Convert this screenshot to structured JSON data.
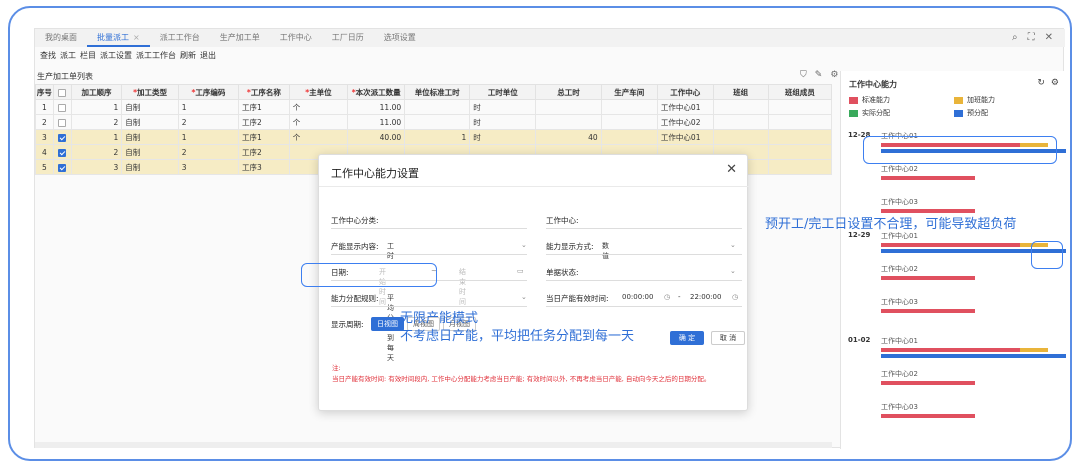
{
  "tabs": [
    {
      "label": "我的桌面",
      "active": false
    },
    {
      "label": "批量派工",
      "active": true,
      "closable": true
    },
    {
      "label": "派工工作台",
      "active": false
    },
    {
      "label": "生产加工单",
      "active": false
    },
    {
      "label": "工作中心",
      "active": false
    },
    {
      "label": "工厂日历",
      "active": false
    },
    {
      "label": "选项设置",
      "active": false
    }
  ],
  "tab_close_glyph": "×",
  "window_controls": [
    "search-icon",
    "expand-icon",
    "close-icon"
  ],
  "window_control_glyphs": [
    "⌕",
    "⛶",
    "✕"
  ],
  "menu": [
    "查找",
    "派工",
    "栏目",
    "派工设置",
    "派工工作台",
    "刷新",
    "退出"
  ],
  "list_title": "生产加工单列表",
  "list_icons": [
    "filter-icon",
    "edit-icon",
    "settings-icon"
  ],
  "list_icon_glyphs": [
    "⛉",
    "✎",
    "⚙"
  ],
  "table": {
    "columns": [
      {
        "label": "序号",
        "required": false
      },
      {
        "label": "",
        "checkbox": true
      },
      {
        "label": "加工顺序",
        "required": false
      },
      {
        "label": "加工类型",
        "required": true
      },
      {
        "label": "工序编码",
        "required": true
      },
      {
        "label": "工序名称",
        "required": true
      },
      {
        "label": "主单位",
        "required": true
      },
      {
        "label": "本次派工数量",
        "required": true
      },
      {
        "label": "单位标准工时",
        "required": false
      },
      {
        "label": "工时单位",
        "required": false
      },
      {
        "label": "总工时",
        "required": false
      },
      {
        "label": "生产车间",
        "required": false
      },
      {
        "label": "工作中心",
        "required": false
      },
      {
        "label": "班组",
        "required": false
      },
      {
        "label": "班组成员",
        "required": false
      }
    ],
    "rows": [
      {
        "seq": "1",
        "checked": false,
        "order": "1",
        "type": "自制",
        "code": "1",
        "name": "工序1",
        "unit": "个",
        "qty": "11.00",
        "std": "",
        "tunit": "时",
        "total": "",
        "shop": "",
        "center": "工作中心01",
        "team": "",
        "member": "",
        "highlight": false
      },
      {
        "seq": "2",
        "checked": false,
        "order": "2",
        "type": "自制",
        "code": "2",
        "name": "工序2",
        "unit": "个",
        "qty": "11.00",
        "std": "",
        "tunit": "时",
        "total": "",
        "shop": "",
        "center": "工作中心02",
        "team": "",
        "member": "",
        "highlight": false
      },
      {
        "seq": "3",
        "checked": true,
        "order": "1",
        "type": "自制",
        "code": "1",
        "name": "工序1",
        "unit": "个",
        "qty": "40.00",
        "std": "1",
        "tunit": "时",
        "total": "40",
        "shop": "",
        "center": "工作中心01",
        "team": "",
        "member": "",
        "highlight": true
      },
      {
        "seq": "4",
        "checked": true,
        "order": "2",
        "type": "自制",
        "code": "2",
        "name": "工序2",
        "unit": "",
        "qty": "",
        "std": "",
        "tunit": "",
        "total": "",
        "shop": "",
        "center": "",
        "team": "",
        "member": "",
        "highlight": true
      },
      {
        "seq": "5",
        "checked": true,
        "order": "3",
        "type": "自制",
        "code": "3",
        "name": "工序3",
        "unit": "",
        "qty": "",
        "std": "",
        "tunit": "",
        "total": "",
        "shop": "",
        "center": "",
        "team": "",
        "member": "",
        "highlight": true
      }
    ]
  },
  "panel": {
    "title": "工作中心能力",
    "icons": [
      "refresh-icon",
      "settings-icon"
    ],
    "icon_glyphs": [
      "↻",
      "⚙"
    ],
    "legend": [
      {
        "label": "标准能力",
        "color": "#e0505f"
      },
      {
        "label": "加班能力",
        "color": "#e9b43a"
      },
      {
        "label": "实际分配",
        "color": "#3aaa5c"
      },
      {
        "label": "预分配",
        "color": "#2f6fd6"
      }
    ],
    "days": [
      {
        "date": "12-28",
        "centers": [
          {
            "name": "工作中心01",
            "standard": 0.75,
            "overtime": 0.15,
            "preassign": 1.0
          },
          {
            "name": "工作中心02",
            "standard": 0.51
          },
          {
            "name": "工作中心03",
            "standard": 0.51
          }
        ]
      },
      {
        "date": "12-29",
        "centers": [
          {
            "name": "工作中心01",
            "standard": 0.75,
            "overtime": 0.15,
            "preassign": 1.0
          },
          {
            "name": "工作中心02",
            "standard": 0.51
          },
          {
            "name": "工作中心03",
            "standard": 0.51
          }
        ]
      },
      {
        "date": "01-02",
        "centers": [
          {
            "name": "工作中心01",
            "standard": 0.75,
            "overtime": 0.15,
            "preassign": 1.0
          },
          {
            "name": "工作中心02",
            "standard": 0.51
          },
          {
            "name": "工作中心03",
            "standard": 0.51
          }
        ]
      }
    ]
  },
  "dialog": {
    "title": "工作中心能力设置",
    "close_glyph": "✕",
    "fields": {
      "center_category": "工作中心分类:",
      "center": "工作中心:",
      "capacity_content_label": "产能显示内容:",
      "capacity_content_value": "工时",
      "capacity_mode_label": "能力显示方式:",
      "capacity_mode_value": "数值",
      "date_label": "日期:",
      "start_placeholder": "开始时间",
      "date_sep": "~",
      "end_placeholder": "结束时间",
      "doc_status_label": "单据状态:",
      "rule_label": "能力分配规则:",
      "rule_value": "平均分配到每天",
      "valid_time_label": "当日产能有效时间:",
      "valid_start": "00:00:00",
      "valid_sep": "-",
      "valid_end": "22:00:00"
    },
    "period_label": "显示周期:",
    "period_buttons": [
      {
        "label": "日视图",
        "active": true
      },
      {
        "label": "周视图",
        "active": false
      },
      {
        "label": "月视图",
        "active": false
      }
    ],
    "ok": "确 定",
    "cancel": "取 消",
    "note_title": "注:",
    "note_text": "当日产能有效时间: 有效时间段内, 工作中心分配能力考虑当日产能; 有效时间以外, 不再考虑当日产能, 自动向今天之后的日期分配。"
  },
  "annotations": {
    "infinite_mode": "无限产能模式",
    "infinite_desc": "不考虑日产能，平均把任务分配到每一天",
    "overload_warning": "预开工/完工日设置不合理，可能导致超负荷"
  }
}
